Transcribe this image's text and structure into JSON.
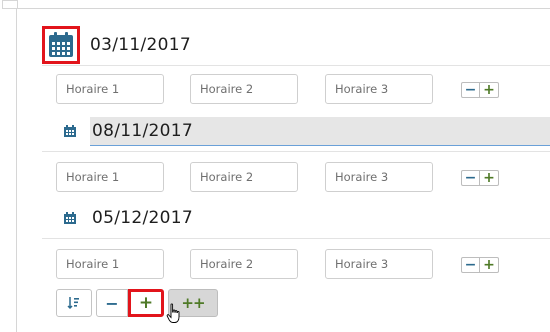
{
  "dates": [
    {
      "label": "03/11/2017"
    },
    {
      "label": "08/11/2017"
    },
    {
      "label": "05/12/2017"
    }
  ],
  "schedule_rows": [
    {
      "placeholders": [
        "Horaire 1",
        "Horaire 2",
        "Horaire 3"
      ]
    },
    {
      "placeholders": [
        "Horaire 1",
        "Horaire 2",
        "Horaire 3"
      ]
    },
    {
      "placeholders": [
        "Horaire 1",
        "Horaire 2",
        "Horaire 3"
      ]
    }
  ],
  "row_controls": {
    "minus": "−",
    "plus": "+"
  },
  "toolbar": {
    "sort_icon": "sort-icon",
    "minus": "−",
    "plus": "+",
    "plus_plus": "++"
  },
  "colors": {
    "calendar": "#2c6a8e",
    "plus": "#4f7a27",
    "minus": "#2c6a8e",
    "highlight_box": "#e2141b",
    "selected_date_bg": "#e6e6e6"
  }
}
